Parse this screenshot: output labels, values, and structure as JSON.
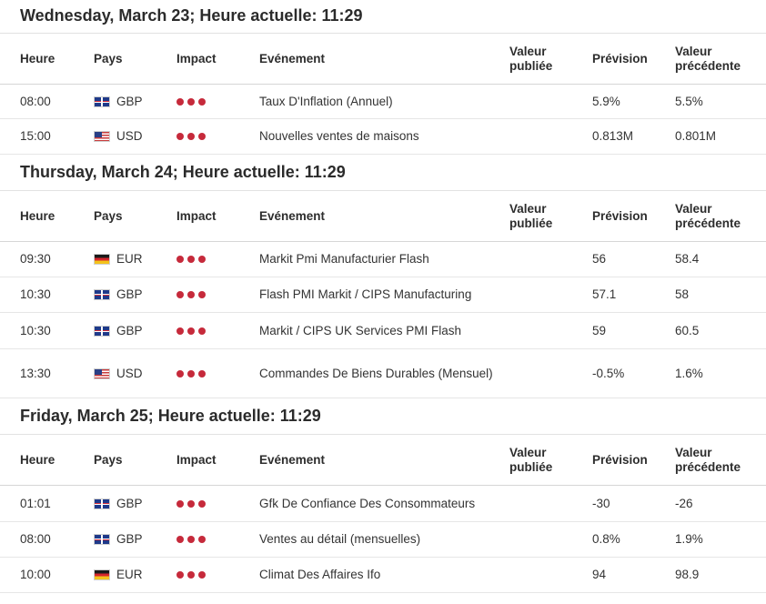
{
  "columns": {
    "time": "Heure",
    "country": "Pays",
    "impact": "Impact",
    "event": "Evénement",
    "actual": "Valeur publiée",
    "forecast": "Prévision",
    "previous": "Valeur précédente"
  },
  "days": [
    {
      "title": "Wednesday, March 23; Heure actuelle: 11:29",
      "events": [
        {
          "time": "08:00",
          "flag": "flag-gbp-icon",
          "currency": "GBP",
          "impact": 3,
          "event": "Taux D'Inflation (Annuel)",
          "actual": "",
          "forecast": "5.9%",
          "previous": "5.5%"
        },
        {
          "time": "15:00",
          "flag": "flag-usd-icon",
          "currency": "USD",
          "impact": 3,
          "event": "Nouvelles ventes de maisons",
          "actual": "",
          "forecast": "0.813M",
          "previous": "0.801M"
        }
      ]
    },
    {
      "title": "Thursday, March 24; Heure actuelle: 11:29",
      "events": [
        {
          "time": "09:30",
          "flag": "flag-eur-icon",
          "currency": "EUR",
          "impact": 3,
          "event": "Markit Pmi Manufacturier Flash",
          "actual": "",
          "forecast": "56",
          "previous": "58.4"
        },
        {
          "time": "10:30",
          "flag": "flag-gbp-icon",
          "currency": "GBP",
          "impact": 3,
          "event": "Flash PMI Markit / CIPS Manufacturing",
          "actual": "",
          "forecast": "57.1",
          "previous": "58"
        },
        {
          "time": "10:30",
          "flag": "flag-gbp-icon",
          "currency": "GBP",
          "impact": 3,
          "event": "Markit / CIPS UK Services PMI Flash",
          "actual": "",
          "forecast": "59",
          "previous": "60.5"
        },
        {
          "time": "13:30",
          "flag": "flag-usd-icon",
          "currency": "USD",
          "impact": 3,
          "event": "Commandes De Biens Durables (Mensuel)",
          "actual": "",
          "forecast": "-0.5%",
          "previous": "1.6%"
        }
      ]
    },
    {
      "title": "Friday, March 25; Heure actuelle: 11:29",
      "events": [
        {
          "time": "01:01",
          "flag": "flag-gbp-icon",
          "currency": "GBP",
          "impact": 3,
          "event": "Gfk De Confiance Des Consommateurs",
          "actual": "",
          "forecast": "-30",
          "previous": "-26"
        },
        {
          "time": "08:00",
          "flag": "flag-gbp-icon",
          "currency": "GBP",
          "impact": 3,
          "event": "Ventes au détail (mensuelles)",
          "actual": "",
          "forecast": "0.8%",
          "previous": "1.9%"
        },
        {
          "time": "10:00",
          "flag": "flag-eur-icon",
          "currency": "EUR",
          "impact": 3,
          "event": "Climat Des Affaires Ifo",
          "actual": "",
          "forecast": "94",
          "previous": "98.9"
        }
      ]
    }
  ],
  "colors": {
    "impact_high": "#c62a3b"
  }
}
